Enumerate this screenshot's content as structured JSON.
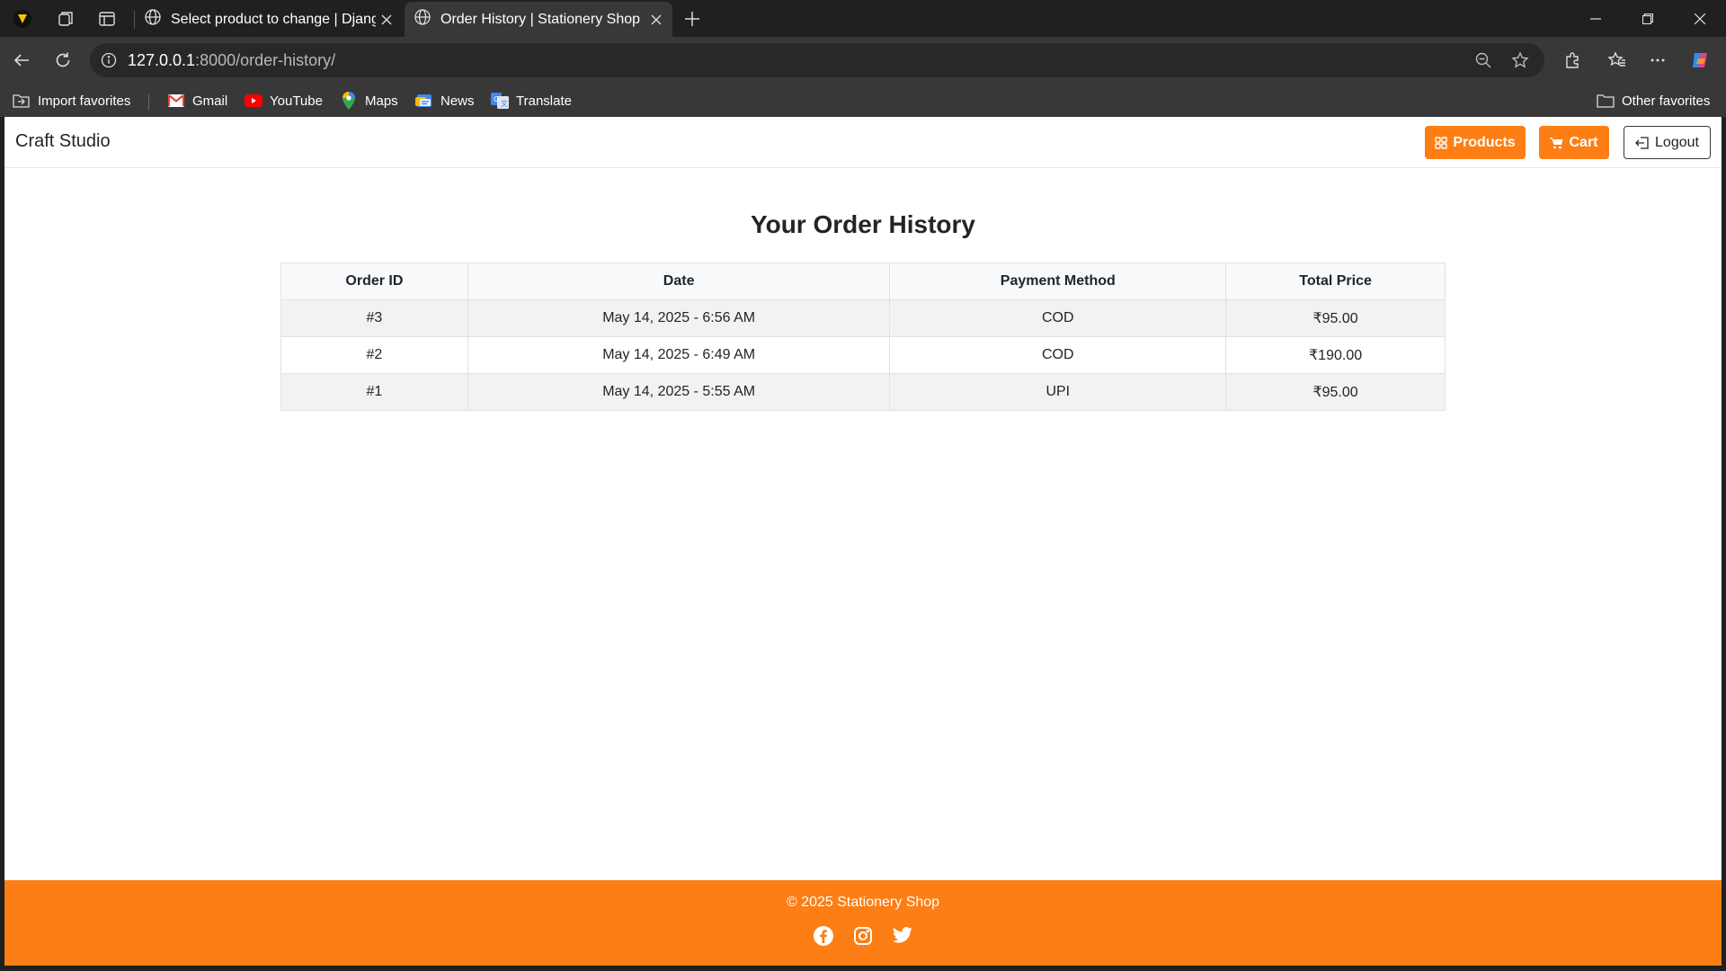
{
  "browser": {
    "tabs": [
      {
        "title": "Select product to change | Django site admin",
        "active": false
      },
      {
        "title": "Order History | Stationery Shop",
        "active": true
      }
    ],
    "url_host": "127.0.0.1",
    "url_path": ":8000/order-history/",
    "bookmarks": [
      {
        "label": "Import favorites",
        "icon": "import-icon"
      },
      {
        "label": "Gmail",
        "icon": "gmail-icon"
      },
      {
        "label": "YouTube",
        "icon": "youtube-icon"
      },
      {
        "label": "Maps",
        "icon": "maps-icon"
      },
      {
        "label": "News",
        "icon": "news-icon"
      },
      {
        "label": "Translate",
        "icon": "translate-icon"
      }
    ],
    "other_favorites": "Other favorites"
  },
  "navbar": {
    "brand": "Craft Studio",
    "products_label": "Products",
    "cart_label": "Cart",
    "logout_label": "Logout"
  },
  "main": {
    "title": "Your Order History",
    "columns": [
      "Order ID",
      "Date",
      "Payment Method",
      "Total Price"
    ],
    "rows": [
      [
        "#3",
        "May 14, 2025 - 6:56 AM",
        "COD",
        "₹95.00"
      ],
      [
        "#2",
        "May 14, 2025 - 6:49 AM",
        "COD",
        "₹190.00"
      ],
      [
        "#1",
        "May 14, 2025 - 5:55 AM",
        "UPI",
        "₹95.00"
      ]
    ]
  },
  "footer": {
    "copyright": "© 2025 Stationery Shop",
    "social": [
      "facebook-icon",
      "instagram-icon",
      "twitter-icon"
    ]
  },
  "colors": {
    "accent": "#fd7e14",
    "chrome_dark": "#202020",
    "chrome_mid": "#383838"
  }
}
